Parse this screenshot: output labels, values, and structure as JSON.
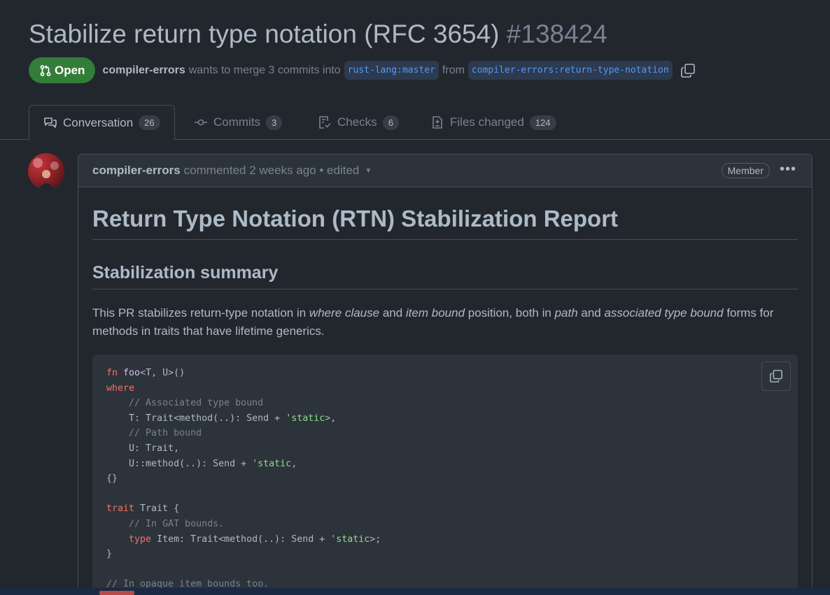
{
  "pr": {
    "title": "Stabilize return type notation (RFC 3654)",
    "number": "#138424",
    "state": "Open",
    "author": "compiler-errors",
    "merge_text": "wants to merge 3 commits into",
    "base_branch": "rust-lang:master",
    "from_text": "from",
    "head_branch": "compiler-errors:return-type-notation"
  },
  "tabs": [
    {
      "label": "Conversation",
      "count": "26",
      "icon": "comment-discussion-icon"
    },
    {
      "label": "Commits",
      "count": "3",
      "icon": "commit-icon"
    },
    {
      "label": "Checks",
      "count": "6",
      "icon": "checklist-icon"
    },
    {
      "label": "Files changed",
      "count": "124",
      "icon": "file-diff-icon"
    }
  ],
  "comment": {
    "author": "compiler-errors",
    "action": "commented 2 weeks ago • edited",
    "role": "Member",
    "heading": "Return Type Notation (RTN) Stabilization Report",
    "subheading": "Stabilization summary",
    "para": {
      "t1": "This PR stabilizes return-type notation in ",
      "e1": "where clause",
      "t2": " and ",
      "e2": "item bound",
      "t3": " position, both in ",
      "e3": "path",
      "t4": " and ",
      "e4": "associated type bound",
      "t5": " forms for methods in traits that have lifetime generics."
    }
  },
  "colors": {
    "background": "#22272e",
    "open_badge": "#347d39",
    "link": "#539bf5"
  }
}
